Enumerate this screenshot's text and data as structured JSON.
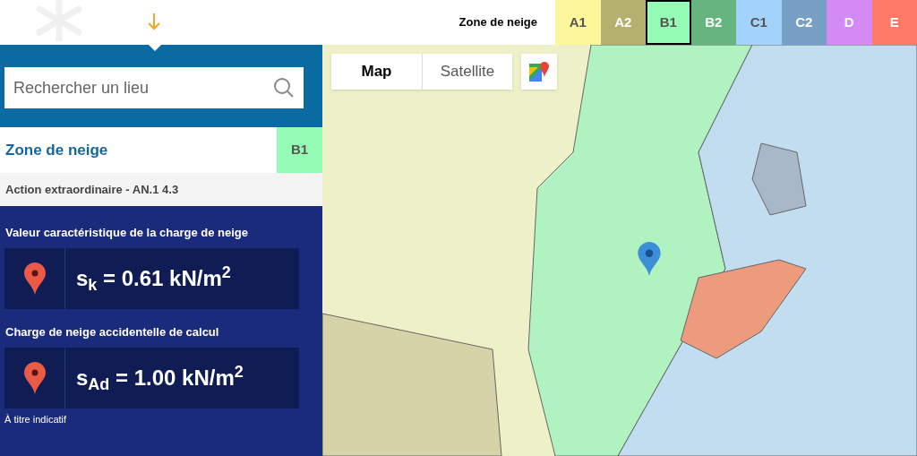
{
  "legend": {
    "title": "Zone de neige",
    "zones": [
      {
        "label": "A1",
        "color": "#fdf79b",
        "selected": false
      },
      {
        "label": "A2",
        "color": "#b5b06e",
        "selected": false
      },
      {
        "label": "B1",
        "color": "#94fcb4",
        "selected": true
      },
      {
        "label": "B2",
        "color": "#66b57f",
        "selected": false
      },
      {
        "label": "C1",
        "color": "#a3d3fd",
        "selected": false
      },
      {
        "label": "C2",
        "color": "#789fc6",
        "selected": false
      },
      {
        "label": "D",
        "color": "#d38af5",
        "selected": false
      },
      {
        "label": "E",
        "color": "#fd7a66",
        "selected": false
      }
    ]
  },
  "search": {
    "placeholder": "Rechercher un lieu"
  },
  "zone_result": {
    "label": "Zone de neige",
    "value": "B1",
    "color": "#94fcb4"
  },
  "subtitle": "Action extraordinaire - AN.1 4.3",
  "results": [
    {
      "label": "Valeur caractéristique de la charge de neige",
      "value": "s$_{k}$ = 0.61 kN/m$^{2}$"
    },
    {
      "label": "Charge de neige accidentelle de calcul",
      "value": "s$_{Ad}$ = 1.00 kN/m$^{2}$"
    }
  ],
  "note": "À titre indicatif",
  "map_tabs": [
    {
      "label": "Map",
      "selected": true
    },
    {
      "label": "Satellite",
      "selected": false
    }
  ]
}
